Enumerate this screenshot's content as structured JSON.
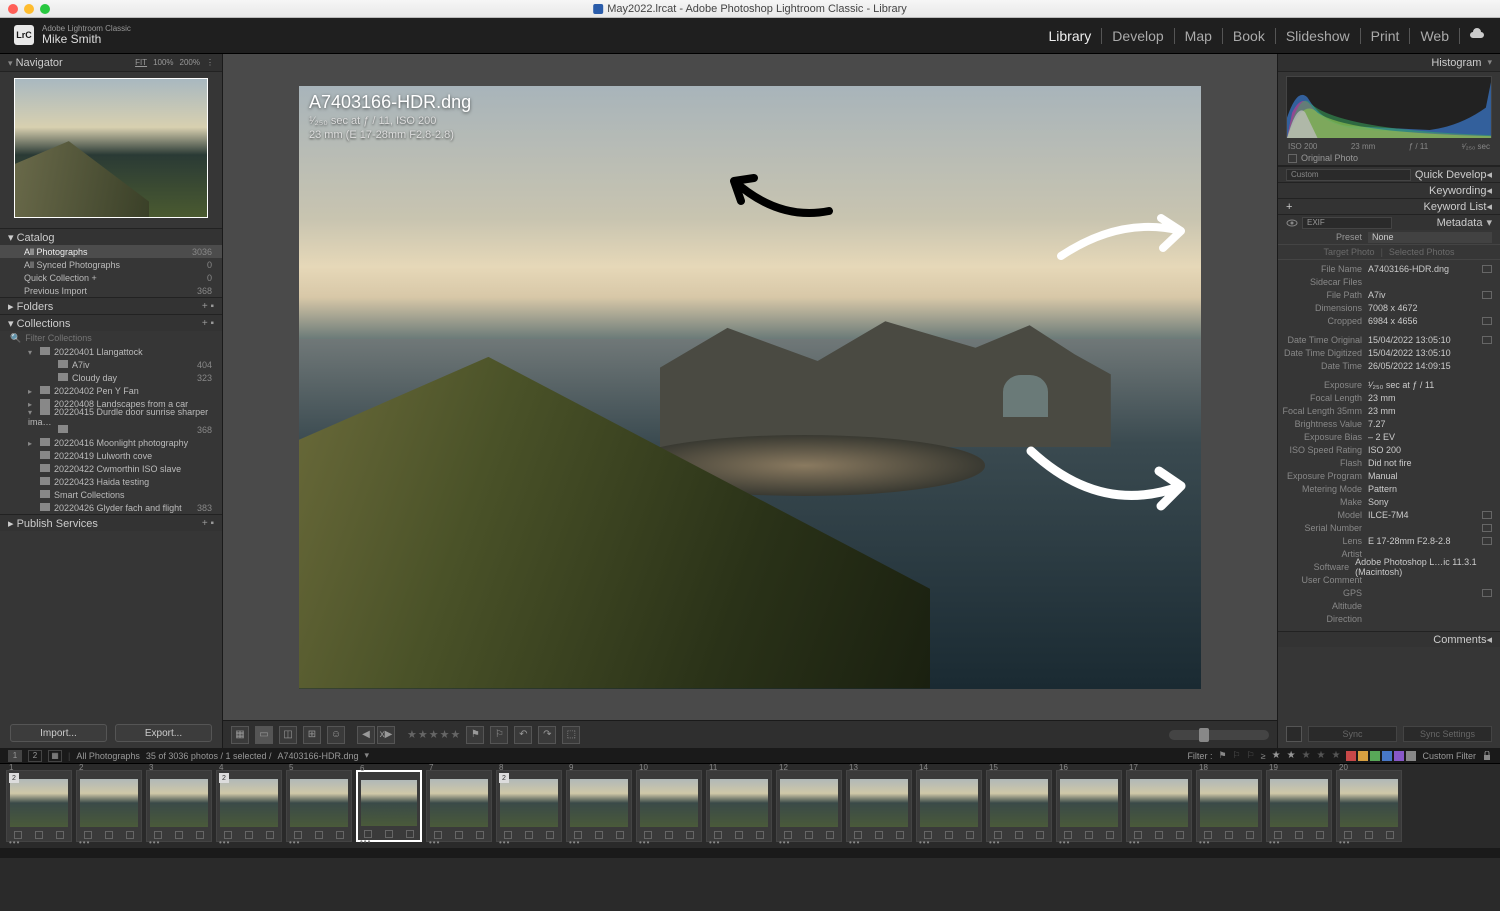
{
  "window_title": "May2022.lrcat - Adobe Photoshop Lightroom Classic - Library",
  "app_label": "Adobe Lightroom Classic",
  "username": "Mike Smith",
  "logo_text": "LrC",
  "modules": [
    {
      "label": "Library",
      "active": true
    },
    {
      "label": "Develop",
      "active": false
    },
    {
      "label": "Map",
      "active": false
    },
    {
      "label": "Book",
      "active": false
    },
    {
      "label": "Slideshow",
      "active": false
    },
    {
      "label": "Print",
      "active": false
    },
    {
      "label": "Web",
      "active": false
    }
  ],
  "left": {
    "navigator": {
      "title": "Navigator",
      "zoom": [
        "FIT",
        "100%",
        "200%"
      ]
    },
    "catalog": {
      "title": "Catalog",
      "items": [
        {
          "label": "All Photographs",
          "count": "3036",
          "selected": true
        },
        {
          "label": "All Synced Photographs",
          "count": "0"
        },
        {
          "label": "Quick Collection +",
          "count": "0"
        },
        {
          "label": "Previous Import",
          "count": "368"
        }
      ]
    },
    "folders": {
      "title": "Folders"
    },
    "collections": {
      "title": "Collections",
      "filter_placeholder": "Filter Collections",
      "items": [
        {
          "chev": "▾",
          "depth": 0,
          "label": "20220401 Llangattock",
          "count": ""
        },
        {
          "chev": "",
          "depth": 1,
          "label": "A7iv",
          "count": "404"
        },
        {
          "chev": "",
          "depth": 1,
          "label": "Cloudy day",
          "count": "323"
        },
        {
          "chev": "▸",
          "depth": 0,
          "label": "20220402 Pen Y Fan",
          "count": ""
        },
        {
          "chev": "▸",
          "depth": 0,
          "label": "20220408 Landscapes from a car",
          "count": ""
        },
        {
          "chev": "▾",
          "depth": 0,
          "label": "20220415 Durdle door sunrise sharper ima…",
          "count": ""
        },
        {
          "chev": "",
          "depth": 1,
          "label": "",
          "count": "368"
        },
        {
          "chev": "▸",
          "depth": 0,
          "label": "20220416 Moonlight photography",
          "count": ""
        },
        {
          "chev": "",
          "depth": 0,
          "label": "20220419 Lulworth cove",
          "count": ""
        },
        {
          "chev": "",
          "depth": 0,
          "label": "20220422 Cwmorthin ISO slave",
          "count": ""
        },
        {
          "chev": "",
          "depth": 0,
          "label": "20220423 Haida testing",
          "count": ""
        },
        {
          "chev": "",
          "depth": 0,
          "label": "Smart Collections",
          "count": ""
        },
        {
          "chev": "",
          "depth": 0,
          "label": "20220426 Glyder fach and flight",
          "count": "383"
        }
      ]
    },
    "publish": {
      "title": "Publish Services"
    },
    "import_label": "Import...",
    "export_label": "Export..."
  },
  "center": {
    "filename": "A7403166-HDR.dng",
    "exposure_line": "¹⁄₂₅₀ sec at ƒ / 11, ISO 200",
    "lens_line": "23 mm (E 17-28mm F2.8-2.8)",
    "toolbar": {
      "stars_value": 0
    }
  },
  "right": {
    "histogram": {
      "title": "Histogram",
      "labels": [
        "ISO 200",
        "23 mm",
        "ƒ / 11",
        "¹⁄₂₅₀ sec"
      ],
      "orig": "Original Photo"
    },
    "quick_develop": {
      "label": "Quick Develop",
      "custom": "Custom"
    },
    "keywording": {
      "label": "Keywording"
    },
    "keyword_list": {
      "label": "Keyword List"
    },
    "metadata": {
      "label": "Metadata",
      "mode": "EXIF",
      "preset_label": "Preset",
      "preset_value": "None",
      "target_photo": "Target Photo",
      "selected_photos": "Selected Photos",
      "rows": [
        {
          "k": "File Name",
          "v": "A7403166-HDR.dng",
          "ic": true
        },
        {
          "k": "Sidecar Files",
          "v": ""
        },
        {
          "k": "File Path",
          "v": "A7iv",
          "ic": true
        },
        {
          "k": "Dimensions",
          "v": "7008 x 4672"
        },
        {
          "k": "Cropped",
          "v": "6984 x 4656",
          "ic": true,
          "gapafter": true
        },
        {
          "k": "Date Time Original",
          "v": "15/04/2022 13:05:10",
          "ic": true
        },
        {
          "k": "Date Time Digitized",
          "v": "15/04/2022 13:05:10"
        },
        {
          "k": "Date Time",
          "v": "26/05/2022 14:09:15",
          "gapafter": true
        },
        {
          "k": "Exposure",
          "v": "¹⁄₂₅₀ sec at ƒ / 11"
        },
        {
          "k": "Focal Length",
          "v": "23 mm"
        },
        {
          "k": "Focal Length 35mm",
          "v": "23 mm"
        },
        {
          "k": "Brightness Value",
          "v": "7.27"
        },
        {
          "k": "Exposure Bias",
          "v": "– 2 EV"
        },
        {
          "k": "ISO Speed Rating",
          "v": "ISO 200"
        },
        {
          "k": "Flash",
          "v": "Did not fire"
        },
        {
          "k": "Exposure Program",
          "v": "Manual"
        },
        {
          "k": "Metering Mode",
          "v": "Pattern"
        },
        {
          "k": "Make",
          "v": "Sony"
        },
        {
          "k": "Model",
          "v": "ILCE-7M4",
          "ic": true
        },
        {
          "k": "Serial Number",
          "v": "",
          "ic": true
        },
        {
          "k": "Lens",
          "v": "E 17-28mm F2.8-2.8",
          "ic": true
        },
        {
          "k": "Artist",
          "v": ""
        },
        {
          "k": "Software",
          "v": "Adobe Photoshop L…ic 11.3.1 (Macintosh)"
        },
        {
          "k": "User Comment",
          "v": ""
        },
        {
          "k": "GPS",
          "v": "",
          "ic": true
        },
        {
          "k": "Altitude",
          "v": ""
        },
        {
          "k": "Direction",
          "v": ""
        }
      ]
    },
    "comments": {
      "label": "Comments"
    },
    "sync": {
      "sync_label": "Sync",
      "sync_settings": "Sync Settings"
    }
  },
  "filterbar": {
    "source_label": "All Photographs",
    "count_text": "35 of 3036 photos / 1 selected /",
    "current_file": "A7403166-HDR.dng",
    "filter_label": "Filter :",
    "custom_filter": "Custom Filter",
    "color_chips": [
      "#c84848",
      "#d8a040",
      "#58a858",
      "#4878c8",
      "#8858c8",
      "#888"
    ]
  },
  "filmstrip": {
    "thumbs": [
      {
        "n": "1",
        "badge": "2"
      },
      {
        "n": "2"
      },
      {
        "n": "3"
      },
      {
        "n": "4",
        "badge": "2"
      },
      {
        "n": "5"
      },
      {
        "n": "6",
        "selected": true
      },
      {
        "n": "7"
      },
      {
        "n": "8",
        "badge": "2"
      },
      {
        "n": "9"
      },
      {
        "n": "10"
      },
      {
        "n": "11"
      },
      {
        "n": "12"
      },
      {
        "n": "13"
      },
      {
        "n": "14"
      },
      {
        "n": "15"
      },
      {
        "n": "16"
      },
      {
        "n": "17"
      },
      {
        "n": "18"
      },
      {
        "n": "19"
      },
      {
        "n": "20"
      }
    ]
  }
}
